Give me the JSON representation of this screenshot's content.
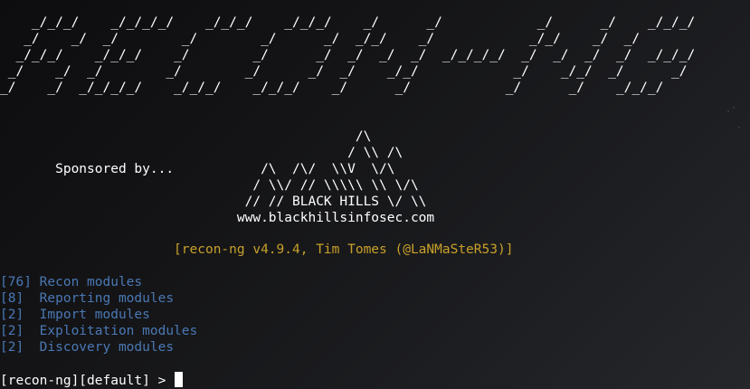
{
  "terminal": {
    "banner": [
      "    _/_/_/    _/_/_/_/    _/_/_/    _/_/_/    _/      _/            _/      _/    _/_/_/",
      "   _/    _/  _/        _/        _/      _/  _/_/    _/            _/_/    _/  _/",
      "  _/_/_/    _/_/_/    _/        _/      _/  _/  _/  _/  _/_/_/_/  _/  _/  _/  _/  _/_/_/",
      " _/    _/  _/        _/        _/      _/  _/    _/_/            _/    _/_/  _/      _/",
      "_/    _/  _/_/_/_/    _/_/_/    _/_/_/    _/      _/            _/      _/    _/_/_/"
    ],
    "sponsor_art": [
      "                                             /\\",
      "                                            / \\\\ /\\",
      "       Sponsored by...           /\\  /\\/  \\\\V  \\/\\",
      "                                / \\\\/ // \\\\\\\\\\ \\\\ \\/\\",
      "                               // // BLACK HILLS \\/ \\\\",
      "                              www.blackhillsinfosec.com"
    ],
    "version": "                      [recon-ng v4.9.4, Tim Tomes (@LaNMaSteR53)]",
    "modules": [
      "[76] Recon modules",
      "[8]  Reporting modules",
      "[2]  Import modules",
      "[2]  Exploitation modules",
      "[2]  Discovery modules"
    ],
    "prompt": "[recon-ng][default] > "
  },
  "colors": {
    "background": "#141416",
    "text": "#ffffff",
    "version": "#c8a02a",
    "modules": "#4a78b5"
  }
}
